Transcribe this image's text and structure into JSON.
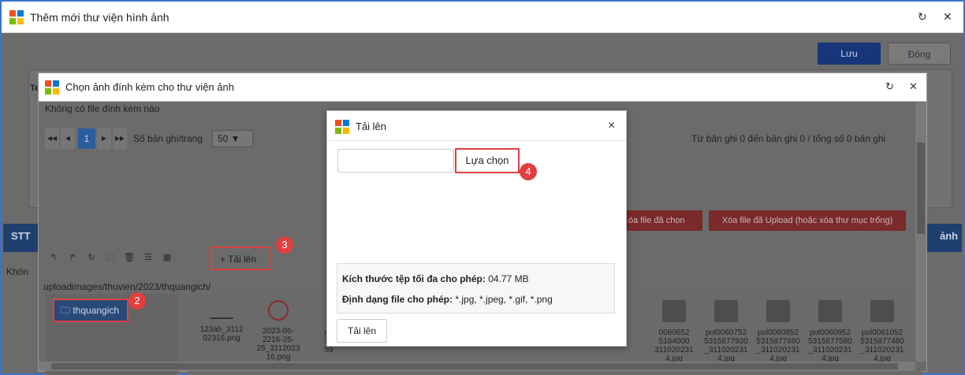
{
  "outer_window": {
    "title": "Thêm mới thư viện hình ảnh",
    "refresh_glyph": "↻",
    "close_glyph": "✕",
    "save_label": "Lưu",
    "close_label": "Đóng",
    "bg_te": "Te",
    "stt_header": "STT",
    "anh_header": "ảnh",
    "khong_text": "Khôn"
  },
  "picker_dialog": {
    "title": "Chọn ảnh đính kèm cho thư viện ảnh",
    "no_attachment_text": "Không có file đính kèm nào",
    "pager": {
      "first": "◀◀",
      "prev": "◀",
      "current_page": "1",
      "next": "▶",
      "last": "▶▶",
      "per_page_label": "Số bản ghi/trang",
      "per_page_value": "50 ▼"
    },
    "records_text": "Từ bản ghi 0 đến bản ghi 0 / tổng số 0 bản ghi",
    "delete_selected_label": "óa file đã chọn",
    "delete_uploaded_label": "Xóa file đã Upload (hoặc xóa thư mục trống)",
    "toolbar_upload_label": "+ Tải lên",
    "path": "uploadimages/thuvien/2023/thquangich/",
    "tree_folder": "🗀 thquangich",
    "files": [
      {
        "name": "123ab_3112\n02316.png",
        "kind": "sig"
      },
      {
        "name": "2023-06-\n2216-25-\n25_3112023\n16.png",
        "kind": "seal"
      },
      {
        "name": "an\nm\n59",
        "kind": "plain"
      },
      {
        "name": "0060652\n5164000\n311020231\n4.jpg",
        "kind": "photo"
      },
      {
        "name": "pol0060752\n5315877930\n_311020231\n4.jpg",
        "kind": "photo"
      },
      {
        "name": "pol0060852\n5315877680\n_311020231\n4.jpg",
        "kind": "photo"
      },
      {
        "name": "pol0060952\n5315877580\n_311020231\n4.jpg",
        "kind": "photo"
      },
      {
        "name": "pol0061052\n5315877480\n_311020231\n4.jpg",
        "kind": "photo"
      }
    ]
  },
  "upload_modal": {
    "title": "Tải lên",
    "close_glyph": "×",
    "choose_label": "Lựa chọn",
    "max_size_label": "Kích thước tệp tối đa cho phép:",
    "max_size_value": "04.77 MB",
    "formats_label": "Định dạng file cho phép:",
    "formats_value": "*.jpg, *.jpeg, *.gif, *.png",
    "upload_button": "Tải lên"
  },
  "steps": {
    "step2": "2",
    "step3": "3",
    "step4": "4"
  },
  "colors": {
    "accent_red": "#e04040",
    "window_border": "#3b74c9"
  }
}
